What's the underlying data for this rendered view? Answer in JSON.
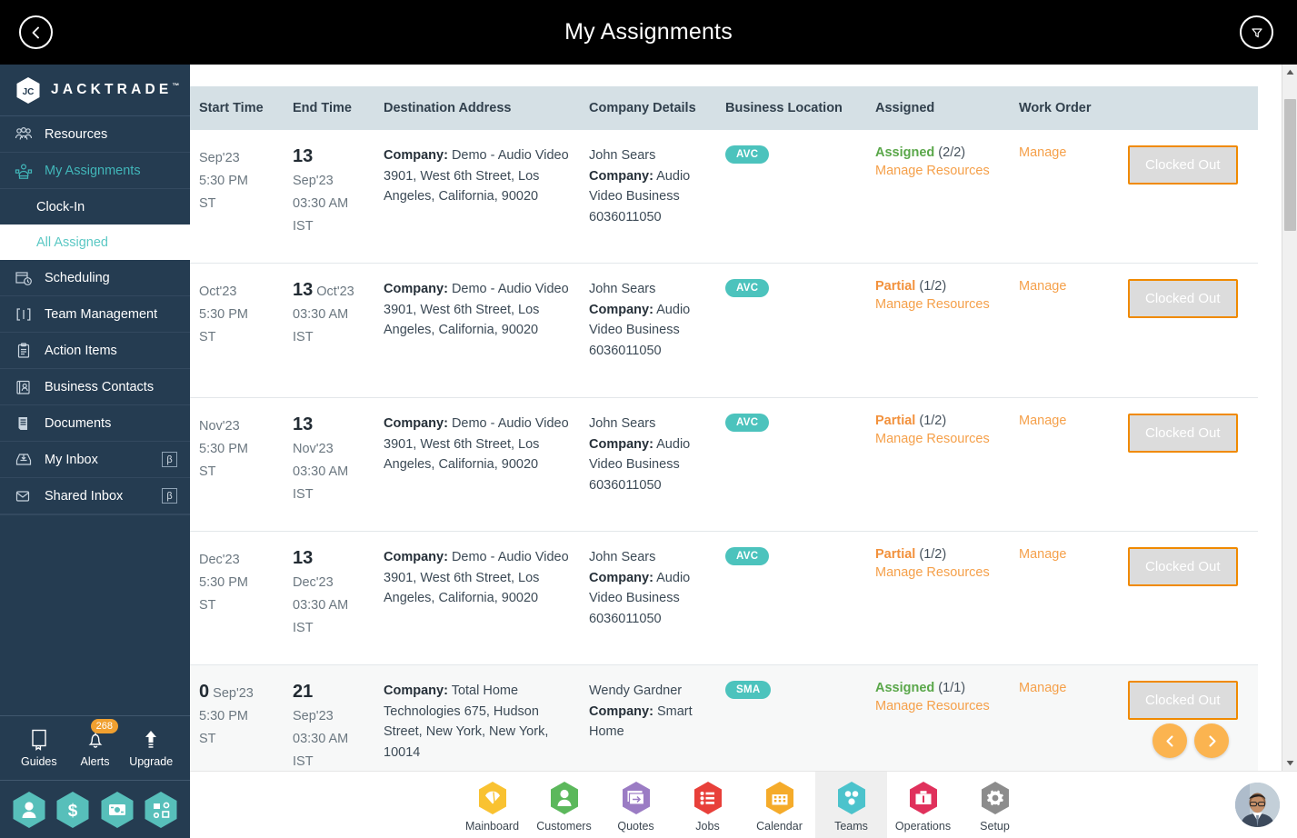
{
  "header": {
    "title": "My Assignments",
    "back_icon": "chevron-left-icon",
    "filter_icon": "funnel-icon"
  },
  "sidebar": {
    "brand": {
      "name": "JACKTRADE",
      "tm": "™"
    },
    "items": [
      {
        "label": "Resources",
        "icon": "resources-icon",
        "active": false
      },
      {
        "label": "My Assignments",
        "icon": "assignments-icon",
        "active": true
      },
      {
        "label": "Scheduling",
        "icon": "calendar-clock-icon",
        "active": false
      },
      {
        "label": "Team Management",
        "icon": "team-icon",
        "active": false
      },
      {
        "label": "Action Items",
        "icon": "clipboard-icon",
        "active": false
      },
      {
        "label": "Business Contacts",
        "icon": "contact-card-icon",
        "active": false
      },
      {
        "label": "Documents",
        "icon": "document-icon",
        "active": false
      },
      {
        "label": "My Inbox",
        "icon": "inbox-icon",
        "active": false,
        "badge": "β"
      },
      {
        "label": "Shared Inbox",
        "icon": "envelope-icon",
        "active": false,
        "badge": "β"
      }
    ],
    "subitems": [
      {
        "label": "Clock-In",
        "selected": false
      },
      {
        "label": "All Assigned",
        "selected": true
      }
    ],
    "tools": [
      {
        "label": "Guides",
        "icon": "book-icon"
      },
      {
        "label": "Alerts",
        "icon": "bell-icon",
        "badge": "268"
      },
      {
        "label": "Upgrade",
        "icon": "arrow-up-icon"
      }
    ],
    "hex_shortcuts": [
      {
        "icon": "user-hex-icon"
      },
      {
        "icon": "dollar-hex-icon"
      },
      {
        "icon": "payment-hex-icon"
      },
      {
        "icon": "workflow-hex-icon"
      }
    ]
  },
  "table": {
    "columns": [
      "Start Time",
      "End Time",
      "Destination Address",
      "Company Details",
      "Business Location",
      "Assigned",
      "Work Order",
      ""
    ],
    "rows": [
      {
        "start": {
          "day": "",
          "month": "Sep'23",
          "time": "5:30 PM",
          "tz": "ST"
        },
        "end": {
          "day": "13",
          "month": "Sep'23",
          "time": "03:30 AM",
          "tz": "IST"
        },
        "dest": {
          "label": "Company:",
          "name": "Demo - Audio Video",
          "address": "3901, West 6th Street, Los Angeles, California, 90020"
        },
        "company": {
          "contact": "John Sears",
          "label": "Company:",
          "name": "Audio Video Business",
          "phone": "6036011050"
        },
        "location": "AVC",
        "assigned": {
          "status": "Assigned",
          "count": "(2/2)",
          "state": "ok",
          "link": "Manage Resources"
        },
        "work_order": "Manage",
        "action": "Clocked Out"
      },
      {
        "start": {
          "day": "",
          "month": "Oct'23",
          "time": "5:30 PM",
          "tz": "ST"
        },
        "end": {
          "day": "13",
          "month": "Oct'23",
          "time": "03:30 AM",
          "tz": "IST"
        },
        "dest": {
          "label": "Company:",
          "name": "Demo - Audio Video",
          "address": "3901, West 6th Street, Los Angeles, California, 90020"
        },
        "company": {
          "contact": "John Sears",
          "label": "Company:",
          "name": "Audio Video Business",
          "phone": "6036011050"
        },
        "location": "AVC",
        "assigned": {
          "status": "Partial",
          "count": "(1/2)",
          "state": "partial",
          "link": "Manage Resources"
        },
        "work_order": "Manage",
        "action": "Clocked Out"
      },
      {
        "start": {
          "day": "",
          "month": "Nov'23",
          "time": "5:30 PM",
          "tz": "ST"
        },
        "end": {
          "day": "13",
          "month": "Nov'23",
          "time": "03:30 AM",
          "tz": "IST"
        },
        "dest": {
          "label": "Company:",
          "name": "Demo - Audio Video",
          "address": "3901, West 6th Street, Los Angeles, California, 90020"
        },
        "company": {
          "contact": "John Sears",
          "label": "Company:",
          "name": "Audio Video Business",
          "phone": "6036011050"
        },
        "location": "AVC",
        "assigned": {
          "status": "Partial",
          "count": "(1/2)",
          "state": "partial",
          "link": "Manage Resources"
        },
        "work_order": "Manage",
        "action": "Clocked Out"
      },
      {
        "start": {
          "day": "",
          "month": "Dec'23",
          "time": "5:30 PM",
          "tz": "ST"
        },
        "end": {
          "day": "13",
          "month": "Dec'23",
          "time": "03:30 AM",
          "tz": "IST"
        },
        "dest": {
          "label": "Company:",
          "name": "Demo - Audio Video",
          "address": "3901, West 6th Street, Los Angeles, California, 90020"
        },
        "company": {
          "contact": "John Sears",
          "label": "Company:",
          "name": "Audio Video Business",
          "phone": "6036011050"
        },
        "location": "AVC",
        "assigned": {
          "status": "Partial",
          "count": "(1/2)",
          "state": "partial",
          "link": "Manage Resources"
        },
        "work_order": "Manage",
        "action": "Clocked Out"
      },
      {
        "start": {
          "day": "0",
          "month": "Sep'23",
          "time": "5:30 PM",
          "tz": "ST"
        },
        "end": {
          "day": "21",
          "month": "Sep'23",
          "time": "03:30 AM",
          "tz": "IST"
        },
        "dest": {
          "label": "Company:",
          "name": "Total Home Technologies",
          "address": "675, Hudson Street, New York, New York, 10014"
        },
        "company": {
          "contact": "Wendy Gardner",
          "label": "Company:",
          "name": "Smart Home",
          "phone": ""
        },
        "location": "SMA",
        "assigned": {
          "status": "Assigned",
          "count": "(1/1)",
          "state": "ok",
          "link": "Manage Resources"
        },
        "work_order": "Manage",
        "action": "Clocked Out"
      }
    ],
    "pager": {
      "prev_icon": "chevron-left-icon",
      "next_icon": "chevron-right-icon"
    }
  },
  "bottom_nav": {
    "items": [
      {
        "label": "Mainboard",
        "icon": "mainboard-icon",
        "color": "#f9c231",
        "active": false
      },
      {
        "label": "Customers",
        "icon": "customers-icon",
        "color": "#5cb85c",
        "active": false
      },
      {
        "label": "Quotes",
        "icon": "quotes-icon",
        "color": "#9b7cc4",
        "active": false
      },
      {
        "label": "Jobs",
        "icon": "jobs-icon",
        "color": "#e8403a",
        "active": false
      },
      {
        "label": "Calendar",
        "icon": "calendar-icon",
        "color": "#f5ab2a",
        "active": false
      },
      {
        "label": "Teams",
        "icon": "teams-icon",
        "color": "#4cc3cc",
        "active": true
      },
      {
        "label": "Operations",
        "icon": "operations-icon",
        "color": "#e0315c",
        "active": false
      },
      {
        "label": "Setup",
        "icon": "setup-icon",
        "color": "#8c8c8c",
        "active": false
      }
    ],
    "avatar": "user-avatar"
  },
  "colors": {
    "accent_orange": "#f08a00",
    "teal": "#4cc3bd",
    "sidebar_bg": "#253c51",
    "header_bg": "#d5e0e5",
    "assigned_green": "#5aa74a"
  }
}
